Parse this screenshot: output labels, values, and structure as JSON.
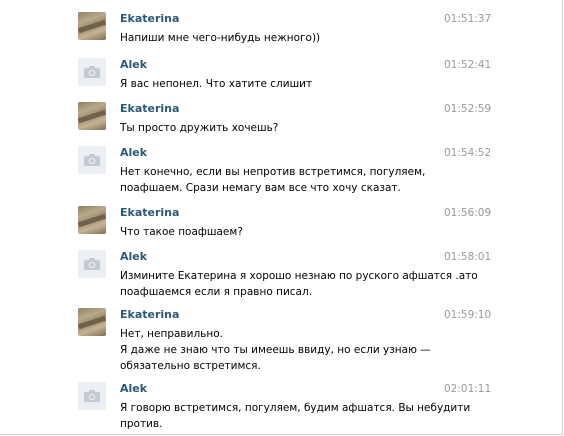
{
  "messages": [
    {
      "author": "Ekaterina",
      "avatar": "photo",
      "time": "01:51:37",
      "lines": [
        "Напиши мне чего-нибудь нежного))"
      ]
    },
    {
      "author": "Alek",
      "avatar": "camera-icon",
      "time": "01:52:41",
      "lines": [
        "Я вас непонел. Что хатите слишит"
      ]
    },
    {
      "author": "Ekaterina",
      "avatar": "photo",
      "time": "01:52:59",
      "lines": [
        "Ты просто дружить хочешь?"
      ]
    },
    {
      "author": "Alek",
      "avatar": "camera-icon",
      "time": "01:54:52",
      "lines": [
        "Нет конечно, если вы непротив встретимся, погуляем,",
        "поафшаем. Срази немагу вам все что хочу сказат."
      ]
    },
    {
      "author": "Ekaterina",
      "avatar": "photo",
      "time": "01:56:09",
      "lines": [
        "Что такое поафшаем?"
      ]
    },
    {
      "author": "Alek",
      "avatar": "camera-icon",
      "time": "01:58:01",
      "lines": [
        "Измините Екатерина я хорошо незнаю по руского афшатся .ато",
        "поафшаемся если я правно писал."
      ]
    },
    {
      "author": "Ekaterina",
      "avatar": "photo",
      "time": "01:59:10",
      "lines": [
        "Нет, неправильно.",
        "Я даже не знаю что ты имеешь ввиду, но если узнаю —",
        "обязательно встретимся."
      ]
    },
    {
      "author": "Alek",
      "avatar": "camera-icon",
      "time": "02:01:11",
      "lines": [
        "Я говорю встретимся, погуляем, будим афшатся. Вы небудити",
        "против."
      ]
    }
  ]
}
